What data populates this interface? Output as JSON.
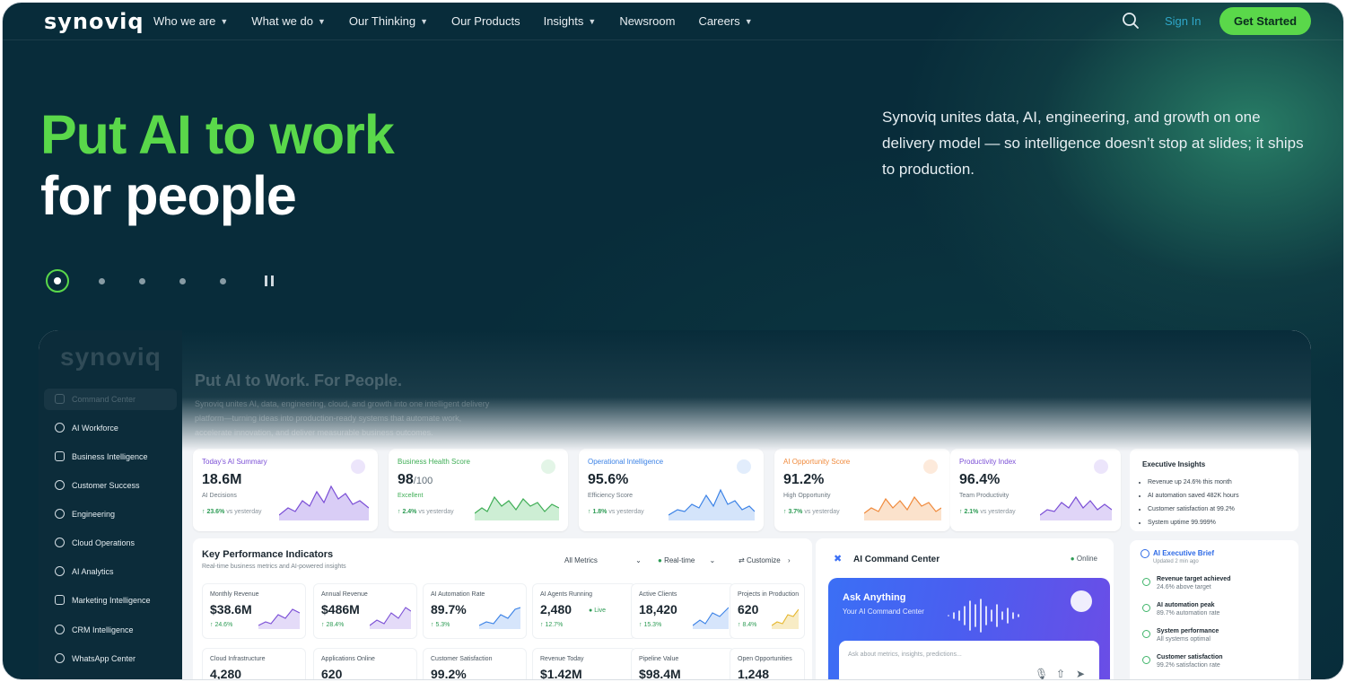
{
  "nav": {
    "logo": "synoviq",
    "items": [
      {
        "label": "Who we are",
        "dropdown": true
      },
      {
        "label": "What we do",
        "dropdown": true
      },
      {
        "label": "Our Thinking",
        "dropdown": true
      },
      {
        "label": "Our Products",
        "dropdown": false
      },
      {
        "label": "Insights",
        "dropdown": true
      },
      {
        "label": "Newsroom",
        "dropdown": false
      },
      {
        "label": "Careers",
        "dropdown": true
      }
    ],
    "signin": "Sign In",
    "cta": "Get Started"
  },
  "hero": {
    "line1": "Put AI to work",
    "line2": "for people",
    "description": "Synoviq unites data, AI, engineering, and growth on one delivery model — so intelligence doesn’t stop at slides; it ships to production."
  },
  "dashboard": {
    "logo": "synoviq",
    "title": "Put AI to Work. For People.",
    "subtitle": "Synoviq unites AI, data, engineering, cloud, and growth into one intelligent delivery platform—turning ideas into production-ready systems that automate work, accelerate innovation, and deliver measurable business outcomes.",
    "sidebar": [
      "Command Center",
      "AI Workforce",
      "Business Intelligence",
      "Customer Success",
      "Engineering",
      "Cloud Operations",
      "AI Analytics",
      "Marketing Intelligence",
      "CRM Intelligence",
      "WhatsApp Center"
    ],
    "summary_cards": [
      {
        "label": "Today's AI Summary",
        "value": "18.6M",
        "unit": "",
        "sub": "AI Decisions",
        "trend": "↑ 23.6%",
        "trend_note": "vs yesterday",
        "color": "#7b4fd6",
        "fill": "#b9a3ee"
      },
      {
        "label": "Business Health Score",
        "value": "98",
        "unit": "/100",
        "sub": "Excellent",
        "trend": "↑ 2.4%",
        "trend_note": "vs yesterday",
        "color": "#3fae56",
        "fill": "#a8e2b3"
      },
      {
        "label": "Operational Intelligence",
        "value": "95.6%",
        "unit": "",
        "sub": "Efficiency Score",
        "trend": "↑ 1.8%",
        "trend_note": "vs yesterday",
        "color": "#3b82e6",
        "fill": "#b5d0f7"
      },
      {
        "label": "AI Opportunity Score",
        "value": "91.2%",
        "unit": "",
        "sub": "High Opportunity",
        "trend": "↑ 3.7%",
        "trend_note": "vs yesterday",
        "color": "#f08a3c",
        "fill": "#f8cfa9"
      },
      {
        "label": "Productivity Index",
        "value": "96.4%",
        "unit": "",
        "sub": "Team Productivity",
        "trend": "↑ 2.1%",
        "trend_note": "vs yesterday",
        "color": "#7b4fd6",
        "fill": "#c9b6f0"
      }
    ],
    "executive": {
      "title": "Executive Insights",
      "items": [
        "Revenue up 24.6% this month",
        "AI automation saved 482K hours",
        "Customer satisfaction at 99.2%",
        "System uptime 99.999%"
      ]
    },
    "kpi": {
      "title": "Key Performance Indicators",
      "subtitle": "Real-time business metrics and AI-powered insights",
      "metrics_select": "All Metrics",
      "mode": "Real-time",
      "customize": "Customize",
      "live": "Live",
      "row1": [
        {
          "label": "Monthly Revenue",
          "value": "$38.6M",
          "trend": "↑ 24.6%",
          "color": "#7b4fd6"
        },
        {
          "label": "Annual Revenue",
          "value": "$486M",
          "trend": "↑ 28.4%",
          "color": "#7b4fd6"
        },
        {
          "label": "AI Automation Rate",
          "value": "89.7%",
          "trend": "↑ 5.3%",
          "color": "#3b82e6"
        },
        {
          "label": "AI Agents Running",
          "value": "2,480",
          "trend": "↑ 12.7%",
          "color": "#3b82e6"
        },
        {
          "label": "Active Clients",
          "value": "18,420",
          "trend": "↑ 15.3%",
          "color": "#3b82e6"
        },
        {
          "label": "Projects in Production",
          "value": "620",
          "trend": "↑ 8.4%",
          "color": "#e5b62c"
        }
      ],
      "row2": [
        {
          "label": "Cloud Infrastructure",
          "value": "4,280",
          "color": "#3b82e6"
        },
        {
          "label": "Applications Online",
          "value": "620",
          "color": "#3b82e6"
        },
        {
          "label": "Customer Satisfaction",
          "value": "99.2%",
          "color": "#3b82e6"
        },
        {
          "label": "Revenue Today",
          "value": "$1.42M",
          "color": "#3b82e6"
        },
        {
          "label": "Pipeline Value",
          "value": "$98.4M",
          "color": "#3b82e6"
        },
        {
          "label": "Open Opportunities",
          "value": "1,248",
          "color": "#3b82e6"
        }
      ]
    },
    "ai_center": {
      "title": "AI Command Center",
      "status": "Online",
      "ask_title": "Ask Anything",
      "ask_sub": "Your AI Command Center",
      "placeholder": "Ask about metrics, insights, predictions..."
    },
    "brief": {
      "title": "AI Executive Brief",
      "updated": "Updated 2 min ago",
      "items": [
        {
          "title": "Revenue target achieved",
          "detail": "24.6% above target"
        },
        {
          "title": "AI automation peak",
          "detail": "89.7% automation rate"
        },
        {
          "title": "System performance",
          "detail": "All systems optimal"
        },
        {
          "title": "Customer satisfaction",
          "detail": "99.2% satisfaction rate"
        }
      ]
    }
  }
}
